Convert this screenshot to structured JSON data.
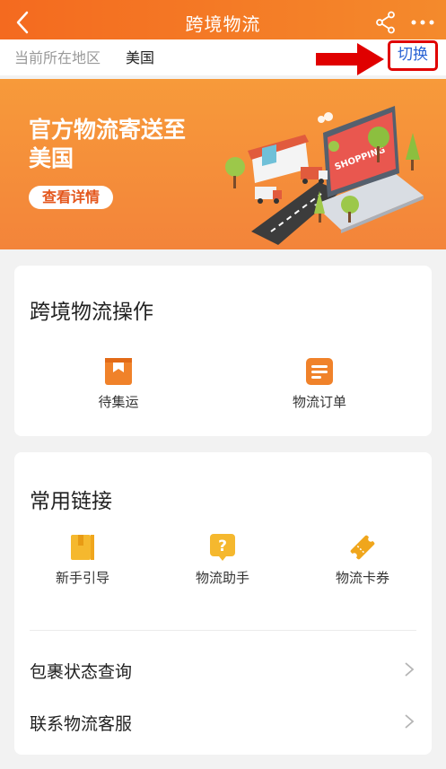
{
  "header": {
    "title": "跨境物流",
    "back_icon": "back-chevron-icon",
    "share_icon": "share-icon",
    "more_icon": "more-dots-icon"
  },
  "region": {
    "label": "当前所在地区",
    "value": "美国",
    "switch_label": "切换"
  },
  "banner": {
    "title": "官方物流寄送至美国",
    "button_label": "查看详情",
    "illustration_sign": "SHOPPING"
  },
  "operations": {
    "title": "跨境物流操作",
    "items": [
      {
        "label": "待集运",
        "icon": "package-bookmark-icon"
      },
      {
        "label": "物流订单",
        "icon": "order-list-icon"
      }
    ]
  },
  "links": {
    "title": "常用链接",
    "items": [
      {
        "label": "新手引导",
        "icon": "guide-book-icon"
      },
      {
        "label": "物流助手",
        "icon": "help-chat-icon"
      },
      {
        "label": "物流卡券",
        "icon": "ticket-icon"
      }
    ],
    "rows": [
      {
        "label": "包裹状态查询"
      },
      {
        "label": "联系物流客服"
      }
    ]
  },
  "colors": {
    "brand": "#f46a1f",
    "accent_link": "#2a63d4",
    "highlight_red": "#e00000",
    "icon_orange": "#f0822a",
    "icon_yellow": "#f5b82e"
  }
}
